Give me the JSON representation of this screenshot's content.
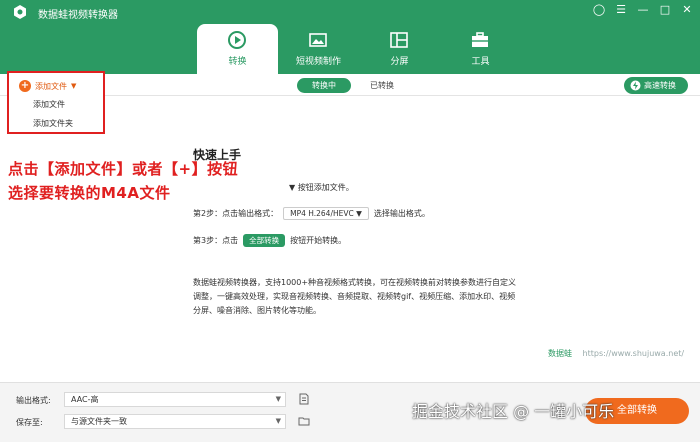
{
  "window": {
    "title": "数据蛙视频转换器",
    "controls": [
      "◯",
      "☰",
      "—",
      "□",
      "✕"
    ]
  },
  "tabs": [
    {
      "label": "转换",
      "icon": "convert-icon",
      "active": true
    },
    {
      "label": "短视频制作",
      "icon": "short-video-icon",
      "active": false
    },
    {
      "label": "分屏",
      "icon": "split-screen-icon",
      "active": false
    },
    {
      "label": "工具",
      "icon": "toolbox-icon",
      "active": false
    }
  ],
  "subbar": {
    "converting": "转换中",
    "converted": "已转换",
    "speed": "高速转换"
  },
  "add_menu": {
    "button": "添加文件",
    "items": [
      "添加文件",
      "添加文件夹"
    ]
  },
  "quickstart": {
    "title": "快速上手",
    "step1_tail": "按钮添加文件。",
    "step2_label": "第2步：点击输出格式：",
    "step2_format": "MP4 H.264/HEVC",
    "step2_tail": "选择输出格式。",
    "step3_label": "第3步：点击",
    "step3_button": "全部转换",
    "step3_tail": "按钮开始转换。"
  },
  "annotation": {
    "line1": "点击【添加文件】或者【+】按钮",
    "line2": "选择要转换的M4A文件"
  },
  "description": "数据蛙视频转换器，支持1000+种音视频格式转换，可在视频转换前对转换参数进行自定义调整，一键高效处理，实现音视频转换、音频提取、视频转gif、视频压缩、添加水印、视频分屏、噪音消除、图片转化等功能。",
  "watermark": {
    "brand": "数据蛙",
    "url": "https://www.shujuwa.net/"
  },
  "footer": {
    "output_label": "输出格式:",
    "output_value": "AAC-高",
    "save_label": "保存至:",
    "save_value": "与源文件夹一致",
    "convert_all": "全部转换"
  },
  "overlay_watermark": "掘金技术社区 @ 一罐小可乐",
  "colors": {
    "brand_green": "#2b9a63",
    "accent_orange": "#f06a1e",
    "annotation_red": "#e02020"
  }
}
